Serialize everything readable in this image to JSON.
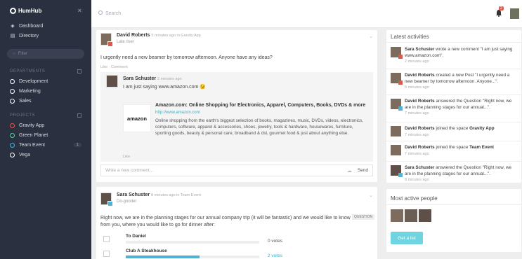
{
  "app": {
    "name": "HumHub"
  },
  "sidebar": {
    "nav": [
      {
        "label": "Dashboard",
        "icon": "dashboard-icon"
      },
      {
        "label": "Directory",
        "icon": "book-icon"
      }
    ],
    "search_placeholder": "Filter",
    "departments_title": "DEPARTMENTS",
    "departments": [
      {
        "label": "Development",
        "color": "#ffffff"
      },
      {
        "label": "Marketing",
        "color": "#ffffff"
      },
      {
        "label": "Sales",
        "color": "#ffffff"
      }
    ],
    "projects_title": "PROJECTS",
    "projects": [
      {
        "label": "Gravity App",
        "color": "#e05b4c"
      },
      {
        "label": "Green Planet",
        "color": "#5bc79a"
      },
      {
        "label": "Team Event",
        "color": "#4fb3d9",
        "badge": "1"
      },
      {
        "label": "Vega",
        "color": "#ffffff"
      }
    ]
  },
  "topbar": {
    "search_placeholder": "Search",
    "notification_count": "2"
  },
  "post1": {
    "author": "David Roberts",
    "meta": "5 minutes ago in Gravity App",
    "subtitle": "Late riser",
    "text": "I urgently need a new beamer by tomorrow afternoon. Anyone have any ideas?",
    "actions": "Like · Comment",
    "comment": {
      "author": "Sara Schuster",
      "meta": "2 minutes ago",
      "text": "I am just saying www.amazon.com 😉"
    },
    "preview": {
      "logo": "amazon",
      "title": "Amazon.com: Online Shopping for Electronics, Apparel, Computers, Books, DVDs & more",
      "url": "http://www.amazon.com",
      "description": "Online shopping from the earth's biggest selection of books, magazines, music, DVDs, videos, electronics, computers, software, apparel & accessories, shoes, jewelry, tools & hardware, housewares, furniture, sporting goods, beauty & personal care, broadband & dsl, gourmet food & just about anything else."
    },
    "comment_like": "Like",
    "comment_placeholder": "Write a new comment...",
    "send_label": "Send"
  },
  "post2": {
    "author": "Sara Schuster",
    "meta": "8 minutes ago in Team Event",
    "subtitle": "Do-gooder",
    "text": "Right now, we are in the planning stages for our annual company trip (it will be fantastic) and we would like to know from you, where you would like to go for dinner after:",
    "tag": "QUESTION",
    "options": [
      {
        "label": "To Daniel",
        "votes": "0 votes",
        "pct": 0
      },
      {
        "label": "Club A Steakhouse",
        "votes": "2 votes",
        "pct": 0.55
      }
    ]
  },
  "activities": {
    "title": "Latest activities",
    "items": [
      {
        "name": "Sara Schuster",
        "text": "wrote a new comment \"I am just saying www.amazon.com\".",
        "time": "2 minutes ago"
      },
      {
        "name": "David Roberts",
        "text": "created a new Post \"I urgently need a new beamer by tomorrow afternoon. Anyone...\".",
        "time": "5 minutes ago"
      },
      {
        "name": "David Roberts",
        "text": "answered the Question \"Right now, we are in the planning stages for our annual...\".",
        "time": "7 minutes ago"
      },
      {
        "name": "David Roberts",
        "text": "joined the space",
        "space": "Gravity App",
        "time": "7 minutes ago"
      },
      {
        "name": "David Roberts",
        "text": "joined the space",
        "space": "Team Event",
        "time": "7 minutes ago"
      },
      {
        "name": "Sara Schuster",
        "text": "answered the Question \"Right now, we are in the planning stages for our annual...\".",
        "time": "8 minutes ago"
      }
    ]
  },
  "active_people": {
    "title": "Most active people",
    "button": "Get a list"
  }
}
